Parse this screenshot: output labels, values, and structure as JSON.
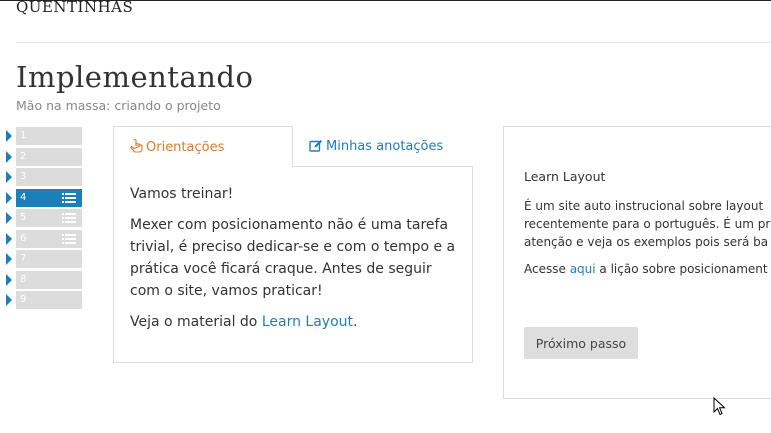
{
  "header": {
    "brand": "QUENTINHAS"
  },
  "page": {
    "title": "Implementando",
    "subtitle": "Mão na massa: criando o projeto"
  },
  "steps": [
    {
      "num": "1",
      "active": false,
      "has_list": false
    },
    {
      "num": "2",
      "active": false,
      "has_list": false
    },
    {
      "num": "3",
      "active": false,
      "has_list": false
    },
    {
      "num": "4",
      "active": true,
      "has_list": true
    },
    {
      "num": "5",
      "active": false,
      "has_list": true
    },
    {
      "num": "6",
      "active": false,
      "has_list": true
    },
    {
      "num": "7",
      "active": false,
      "has_list": false
    },
    {
      "num": "8",
      "active": false,
      "has_list": false
    },
    {
      "num": "9",
      "active": false,
      "has_list": false
    }
  ],
  "tabs": [
    {
      "label": "Orientações",
      "icon": "pointing-hand-icon"
    },
    {
      "label": "Minhas anotações",
      "icon": "edit-icon"
    }
  ],
  "orientation": {
    "heading": "Vamos treinar!",
    "body": "Mexer com posicionamento não é uma tarefa trivial, é preciso dedicar-se e com o tempo e a prática você ficará craque. Antes de seguir com o site, vamos praticar!",
    "material_prefix": "Veja o material do ",
    "material_link": "Learn Layout",
    "material_suffix": "."
  },
  "learn": {
    "title": "Learn Layout",
    "line1": "É um site auto instrucional sobre layout",
    "line2": "recentemente para o português. É um pr",
    "line3": "atenção e veja os exemplos pois será ba",
    "access_prefix": "Acesse ",
    "access_link": "aqui",
    "access_suffix": " a lição sobre posicionament",
    "next_button": "Próximo passo"
  },
  "colors": {
    "accent": "#1b7fb8",
    "tab_active": "#e07b2a",
    "step_inactive": "#dcdcdc"
  }
}
